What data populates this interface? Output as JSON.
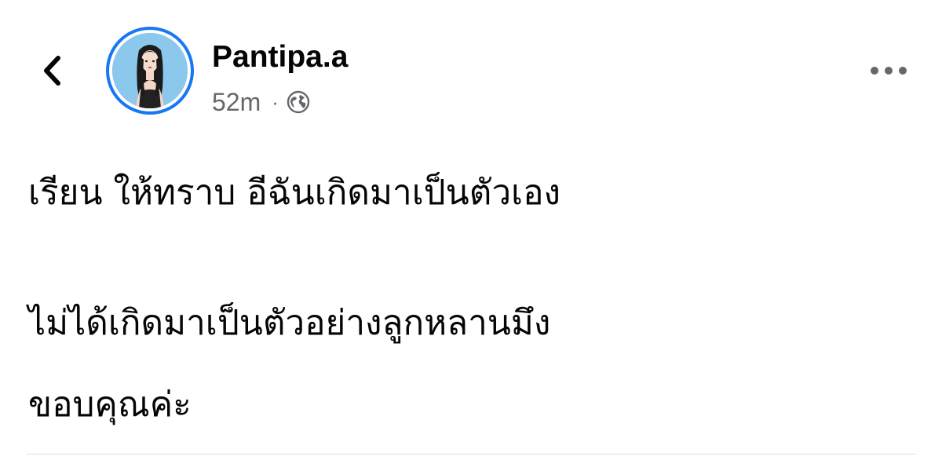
{
  "post": {
    "author": "Pantipa.a",
    "timestamp": "52m",
    "separator": "·",
    "privacy_icon": "globe-icon",
    "lines": [
      "เรียน ให้ทราบ อีฉันเกิดมาเป็นตัวเอง",
      "ไม่ได้เกิดมาเป็นตัวอย่างลูกหลานมึง",
      "ขอบคุณค่ะ"
    ]
  },
  "icons": {
    "back": "chevron-left-icon",
    "more": "more-horizontal-icon"
  },
  "colors": {
    "avatar_ring": "#1877f2",
    "meta_text": "#65676b",
    "body_text": "#050505",
    "divider": "#dadde1"
  }
}
